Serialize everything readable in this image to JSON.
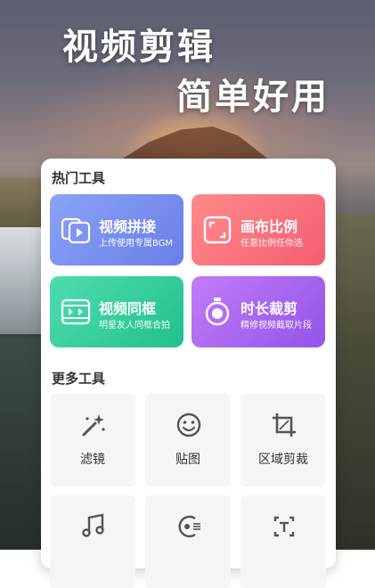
{
  "banner": {
    "line1": "视频剪辑",
    "line2": "简单好用"
  },
  "sections": {
    "hot_title": "热门工具",
    "more_title": "更多工具"
  },
  "hot_tools": [
    {
      "title": "视频拼接",
      "subtitle": "上传使用专属BGM",
      "icon": "video-merge-icon",
      "color": "#7a8ff0"
    },
    {
      "title": "画布比例",
      "subtitle": "任意比例任你选",
      "icon": "canvas-ratio-icon",
      "color": "#f7707e"
    },
    {
      "title": "视频同框",
      "subtitle": "明星友人同框合拍",
      "icon": "video-duet-icon",
      "color": "#36cc9c"
    },
    {
      "title": "时长裁剪",
      "subtitle": "精修视频截取片段",
      "icon": "stopwatch-icon",
      "color": "#a865f0"
    }
  ],
  "more_tools": [
    {
      "label": "滤镜",
      "icon": "magic-wand-icon"
    },
    {
      "label": "贴图",
      "icon": "smiley-sticker-icon"
    },
    {
      "label": "区域剪裁",
      "icon": "crop-icon"
    },
    {
      "label": "",
      "icon": "music-note-icon"
    },
    {
      "label": "",
      "icon": "audio-wave-icon"
    },
    {
      "label": "",
      "icon": "text-box-icon"
    }
  ]
}
